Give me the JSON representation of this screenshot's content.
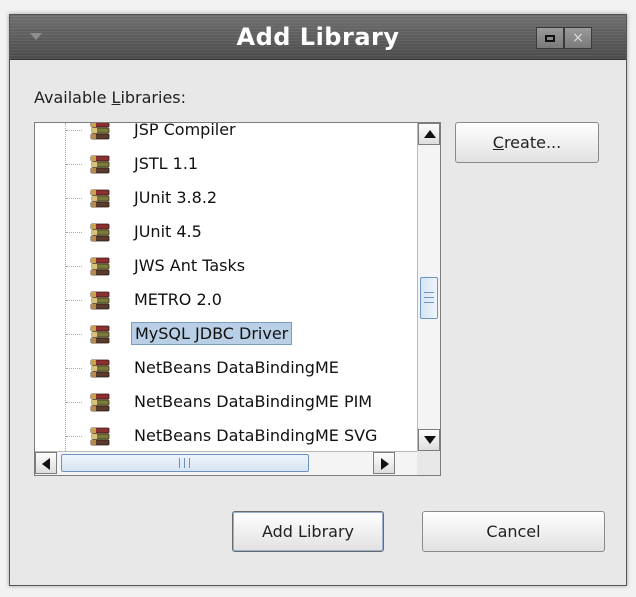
{
  "window": {
    "title": "Add Library",
    "minimize_label": "",
    "close_label": "×"
  },
  "dialog": {
    "available_label_prefix": "Available ",
    "available_label_mnemonic": "L",
    "available_label_suffix": "ibraries:",
    "libraries": [
      {
        "label": "JSP Compiler",
        "selected": false
      },
      {
        "label": "JSTL 1.1",
        "selected": false
      },
      {
        "label": "JUnit 3.8.2",
        "selected": false
      },
      {
        "label": "JUnit 4.5",
        "selected": false
      },
      {
        "label": "JWS Ant Tasks",
        "selected": false
      },
      {
        "label": "METRO 2.0",
        "selected": false
      },
      {
        "label": "MySQL JDBC Driver",
        "selected": true
      },
      {
        "label": "NetBeans DataBindingME",
        "selected": false
      },
      {
        "label": "NetBeans DataBindingME PIM",
        "selected": false
      },
      {
        "label": "NetBeans DataBindingME SVG",
        "selected": false
      }
    ],
    "hscroll_thumb_grip": "|||"
  },
  "buttons": {
    "create_mnemonic": "C",
    "create_rest": "reate...",
    "add_library": "Add Library",
    "cancel": "Cancel"
  },
  "icons": {
    "library": "library-books-icon"
  }
}
